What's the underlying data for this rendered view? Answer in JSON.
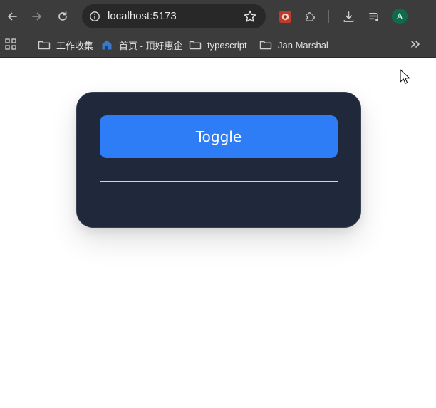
{
  "browser": {
    "url": "localhost:5173",
    "profile_initial": "A",
    "icons": {
      "back": "arrow-left-icon",
      "forward": "arrow-right-icon",
      "reload": "reload-icon",
      "site_info": "info-icon",
      "bookmark_star": "star-icon",
      "extension_app": "extension-app-icon",
      "extensions": "puzzle-icon",
      "downloads": "download-icon",
      "media": "media-control-icon"
    }
  },
  "bookmarks": {
    "items": [
      {
        "label": "工作收集",
        "icon": "folder-icon"
      },
      {
        "label": "首页 - 顶好惠企",
        "icon": "site-favicon"
      },
      {
        "label": "typescript",
        "icon": "folder-icon"
      },
      {
        "label": "Jan Marshal",
        "icon": "folder-icon"
      }
    ],
    "more_icon": "chevron-double-right-icon"
  },
  "main": {
    "toggle_label": "Toggle"
  },
  "colors": {
    "card_bg": "#1f293b",
    "button_bg": "#2f7df6",
    "toolbar_bg": "#3c3c3c"
  }
}
